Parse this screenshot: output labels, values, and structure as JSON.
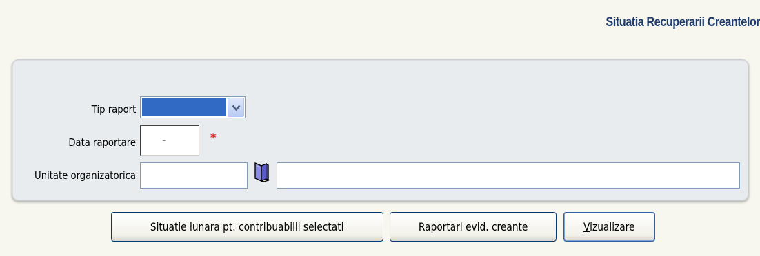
{
  "header": {
    "title": "Situatia Recuperarii Creantelor"
  },
  "form": {
    "tip_raport": {
      "label": "Tip raport",
      "selected_value": ""
    },
    "data_raportare": {
      "label": "Data raportare",
      "value": "-",
      "required_marker": "*"
    },
    "unitate_organizatorica": {
      "label": "Unitate organizatorica",
      "code_value": "",
      "name_value": "",
      "lookup_icon": "book-icon"
    }
  },
  "buttons": {
    "situatie_label": "Situatie lunara pt. contribuabilii selectati",
    "raportari_label": "Raportari evid. creante",
    "vizualizare_first": "V",
    "vizualizare_rest": "izualizare"
  },
  "colors": {
    "title": "#1f3d6e",
    "selection": "#316ac5",
    "required": "#e8211d",
    "panel": "#e9ecef"
  }
}
